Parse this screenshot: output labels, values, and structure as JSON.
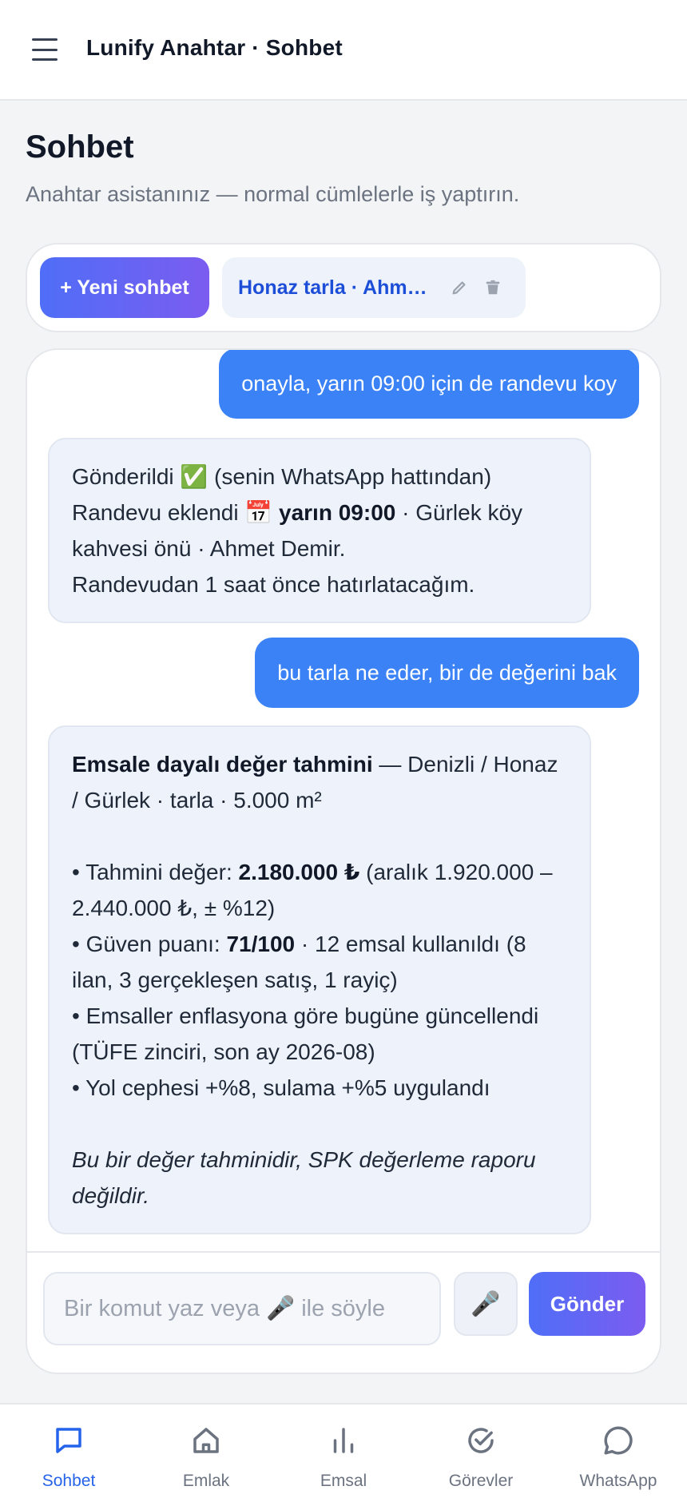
{
  "header": {
    "title": "Lunify Anahtar · Sohbet"
  },
  "page": {
    "title": "Sohbet",
    "subtitle": "Anahtar asistanınız — normal cümlelerle iş yaptırın."
  },
  "sessions": {
    "new_chat_label": "+ Yeni sohbet",
    "active_session": "Honaz tarla · Ahmet Demir"
  },
  "messages": {
    "user_1": "onayla, yarın 09:00 için de randevu koy",
    "assistant_1": {
      "line1": "Gönderildi ✅ (senin WhatsApp hattından)",
      "line2_prefix": "Randevu eklendi 📅 ",
      "line2_bold": "yarın 09:00",
      "line2_suffix": " · Gürlek köy kahvesi önü · Ahmet Demir.",
      "line3": "Randevudan 1 saat önce hatırlatacağım."
    },
    "user_2": "bu tarla ne eder, bir de değerini bak",
    "assistant_2": {
      "heading_bold": "Emsale dayalı değer tahmini",
      "heading_rest": " — Denizli / Honaz / Gürlek · tarla · 5.000 m²",
      "b1_prefix": "• Tahmini değer: ",
      "b1_bold": "2.180.000 ₺",
      "b1_suffix": " (aralık 1.920.000 – 2.440.000 ₺, ± %12)",
      "b2_prefix": "• Güven puanı: ",
      "b2_bold": "71/100",
      "b2_suffix": " · 12 emsal kullanıldı (8 ilan, 3 gerçekleşen satış, 1 rayiç)",
      "b3": "• Emsaller enflasyona göre bugüne güncellendi (TÜFE zinciri, son ay 2026-08)",
      "b4": "• Yol cephesi +%8, sulama +%5 uygulandı",
      "disclaimer": "Bu bir değer tahminidir, SPK değerleme raporu değildir."
    }
  },
  "composer": {
    "placeholder": "Bir komut yaz veya 🎤 ile söyle",
    "mic_glyph": "🎤",
    "send_label": "Gönder"
  },
  "nav": {
    "items": [
      {
        "label": "Sohbet",
        "icon": "chat-bubble-icon",
        "active": true
      },
      {
        "label": "Emlak",
        "icon": "home-icon",
        "active": false
      },
      {
        "label": "Emsal",
        "icon": "bar-chart-icon",
        "active": false
      },
      {
        "label": "Görevler",
        "icon": "check-circle-icon",
        "active": false
      },
      {
        "label": "WhatsApp",
        "icon": "whatsapp-bubble-icon",
        "active": false
      }
    ]
  },
  "colors": {
    "accent": "#3b82f6",
    "accent_gradient_end": "#7b5cf0",
    "nav_active": "#2563eb",
    "nav_inactive": "#6b7280"
  }
}
